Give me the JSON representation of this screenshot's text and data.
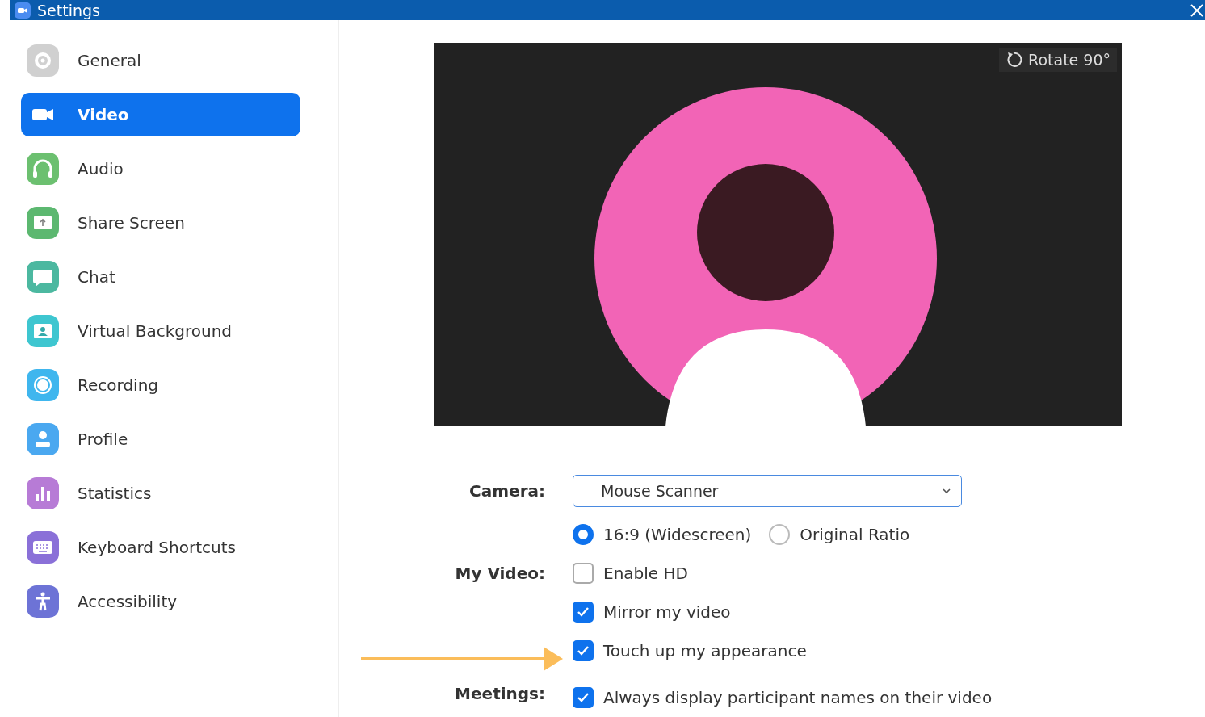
{
  "window": {
    "title": "Settings"
  },
  "sidebar": {
    "items": [
      {
        "label": "General",
        "kind": "gear",
        "color": "#d0d0d0",
        "selected": false
      },
      {
        "label": "Video",
        "kind": "camera",
        "selected": true
      },
      {
        "label": "Audio",
        "kind": "headphones",
        "color": "#6cc070",
        "selected": false
      },
      {
        "label": "Share Screen",
        "kind": "share",
        "color": "#5cb870",
        "selected": false
      },
      {
        "label": "Chat",
        "kind": "chat",
        "color": "#4cb8a0",
        "selected": false
      },
      {
        "label": "Virtual Background",
        "kind": "background",
        "color": "#3ec6d0",
        "selected": false
      },
      {
        "label": "Recording",
        "kind": "record",
        "color": "#3fb6ee",
        "selected": false
      },
      {
        "label": "Profile",
        "kind": "profile",
        "color": "#4aa8f0",
        "selected": false
      },
      {
        "label": "Statistics",
        "kind": "stats",
        "color": "#b77bd6",
        "selected": false
      },
      {
        "label": "Keyboard Shortcuts",
        "kind": "keyboard",
        "color": "#8a70d8",
        "selected": false
      },
      {
        "label": "Accessibility",
        "kind": "accessibility",
        "color": "#6d73d6",
        "selected": false
      }
    ]
  },
  "preview": {
    "rotate_button": "Rotate 90°"
  },
  "camera": {
    "label": "Camera:",
    "device": "Mouse Scanner",
    "ratios": [
      {
        "label": "16:9 (Widescreen)",
        "selected": true
      },
      {
        "label": "Original Ratio",
        "selected": false
      }
    ]
  },
  "my_video": {
    "label": "My Video:",
    "options": [
      {
        "label": "Enable HD",
        "checked": false
      },
      {
        "label": "Mirror my video",
        "checked": true
      },
      {
        "label": "Touch up my appearance",
        "checked": true
      }
    ]
  },
  "meetings": {
    "label": "Meetings:",
    "options": [
      {
        "label": "Always display participant names on their video",
        "checked": true
      }
    ]
  }
}
